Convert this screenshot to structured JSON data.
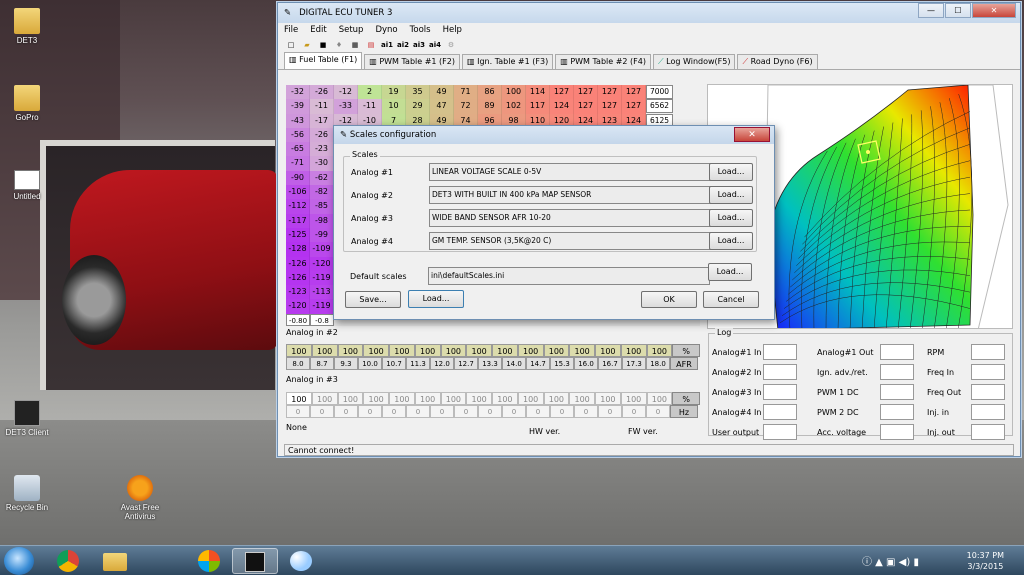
{
  "desktop": {
    "icons": [
      {
        "label": "DET3",
        "icon": "folder-icon"
      },
      {
        "label": "GoPro",
        "icon": "folder-icon"
      },
      {
        "label": "Untitled",
        "icon": "image-file-icon"
      },
      {
        "label": "DET3 Client",
        "icon": "det3-app-icon"
      },
      {
        "label": "Recycle Bin",
        "icon": "recycle-bin-icon"
      },
      {
        "label": "Avast Free Antivirus",
        "icon": "avast-icon"
      }
    ]
  },
  "window": {
    "title": "DIGITAL ECU TUNER 3",
    "controls": {
      "minimize": "—",
      "maximize": "☐",
      "close": "✕"
    },
    "menu": [
      "File",
      "Edit",
      "Setup",
      "Dyno",
      "Tools",
      "Help"
    ],
    "toolbar": [
      "new-icon",
      "open-icon",
      "save-icon",
      "stamp-icon",
      "chip-icon",
      "table-icon",
      "ai1",
      "ai2",
      "ai3",
      "ai4",
      "gear-icon"
    ],
    "tabs": [
      "Fuel Table (F1)",
      "PWM Table #1 (F2)",
      "Ign. Table #1 (F3)",
      "PWM Table #2 (F4)",
      "Log Window(F5)",
      "Road Dyno (F6)"
    ],
    "colors": {
      "accent": "#c7453a",
      "titlebar": "#c6d8ec"
    }
  },
  "fuel_table": {
    "rows": [
      {
        "cells": [
          "-32",
          "-26",
          "-12",
          "2",
          "19",
          "35",
          "49",
          "71",
          "86",
          "100",
          "114",
          "127",
          "127",
          "127",
          "127"
        ],
        "rpm": "7000"
      },
      {
        "cells": [
          "-39",
          "-11",
          "-33",
          "-11",
          "10",
          "29",
          "47",
          "72",
          "89",
          "102",
          "117",
          "124",
          "127",
          "127",
          "127"
        ],
        "rpm": "6562"
      },
      {
        "cells": [
          "-43",
          "-17",
          "-12",
          "-10",
          "7",
          "28",
          "49",
          "74",
          "96",
          "98",
          "110",
          "120",
          "124",
          "123",
          "124"
        ],
        "rpm": "6125"
      },
      {
        "cells": [
          "-56",
          "-26",
          "",
          "",
          "",
          "",
          "",
          "",
          "",
          "",
          "",
          "",
          "",
          "",
          ""
        ],
        "rpm": ""
      },
      {
        "cells": [
          "-65",
          "-23",
          "",
          "",
          "",
          "",
          "",
          "",
          "",
          "",
          "",
          "",
          "",
          "",
          ""
        ],
        "rpm": ""
      },
      {
        "cells": [
          "-71",
          "-30",
          "",
          "",
          "",
          "",
          "",
          "",
          "",
          "",
          "",
          "",
          "",
          "",
          ""
        ],
        "rpm": ""
      },
      {
        "cells": [
          "-90",
          "-62",
          "",
          "",
          "",
          "",
          "",
          "",
          "",
          "",
          "",
          "",
          "",
          "",
          ""
        ],
        "rpm": ""
      },
      {
        "cells": [
          "-106",
          "-82",
          "",
          "",
          "",
          "",
          "",
          "",
          "",
          "",
          "",
          "",
          "",
          "",
          ""
        ],
        "rpm": ""
      },
      {
        "cells": [
          "-112",
          "-85",
          "",
          "",
          "",
          "",
          "",
          "",
          "",
          "",
          "",
          "",
          "",
          "",
          ""
        ],
        "rpm": ""
      },
      {
        "cells": [
          "-117",
          "-98",
          "",
          "",
          "",
          "",
          "",
          "",
          "",
          "",
          "",
          "",
          "",
          "",
          ""
        ],
        "rpm": ""
      },
      {
        "cells": [
          "-125",
          "-99",
          "",
          "",
          "",
          "",
          "",
          "",
          "",
          "",
          "",
          "",
          "",
          "",
          ""
        ],
        "rpm": ""
      },
      {
        "cells": [
          "-128",
          "-109",
          "",
          "",
          "",
          "",
          "",
          "",
          "",
          "",
          "",
          "",
          "",
          "",
          ""
        ],
        "rpm": ""
      },
      {
        "cells": [
          "-126",
          "-120",
          "",
          "",
          "",
          "",
          "",
          "",
          "",
          "",
          "",
          "",
          "",
          "",
          ""
        ],
        "rpm": ""
      },
      {
        "cells": [
          "-126",
          "-119",
          "",
          "",
          "",
          "",
          "",
          "",
          "",
          "",
          "",
          "",
          "",
          "",
          ""
        ],
        "rpm": ""
      },
      {
        "cells": [
          "-123",
          "-113",
          "",
          "",
          "",
          "",
          "",
          "",
          "",
          "",
          "",
          "",
          "",
          "",
          ""
        ],
        "rpm": ""
      },
      {
        "cells": [
          "-120",
          "-119",
          "",
          "",
          "",
          "",
          "",
          "",
          "",
          "",
          "",
          "",
          "",
          "",
          ""
        ],
        "rpm": ""
      }
    ],
    "footer": [
      "-0.80",
      "-0.8"
    ]
  },
  "analog2": {
    "label": "Analog in #2",
    "top": [
      "100",
      "100",
      "100",
      "100",
      "100",
      "100",
      "100",
      "100",
      "100",
      "100",
      "100",
      "100",
      "100",
      "100",
      "100"
    ],
    "top_unit": "%",
    "bottom": [
      "8.0",
      "8.7",
      "9.3",
      "10.0",
      "10.7",
      "11.3",
      "12.0",
      "12.7",
      "13.3",
      "14.0",
      "14.7",
      "15.3",
      "16.0",
      "16.7",
      "17.3",
      "18.0"
    ],
    "bottom_unit": "AFR"
  },
  "analog3": {
    "label": "Analog in #3",
    "top": [
      "100",
      "100",
      "100",
      "100",
      "100",
      "100",
      "100",
      "100",
      "100",
      "100",
      "100",
      "100",
      "100",
      "100",
      "100"
    ],
    "top_unit": "%",
    "bottom": [
      "0",
      "0",
      "0",
      "0",
      "0",
      "0",
      "0",
      "0",
      "0",
      "0",
      "0",
      "0",
      "0",
      "0",
      "0",
      "0"
    ],
    "bottom_unit": "Hz"
  },
  "info": {
    "none": "None",
    "hw": "HW ver.",
    "fw": "FW ver."
  },
  "log": {
    "title": "Log",
    "col1": [
      "Analog#1 In",
      "Analog#2 In",
      "Analog#3 In",
      "Analog#4 In",
      "User output"
    ],
    "col2": [
      "Analog#1 Out",
      "Ign. adv./ret.",
      "PWM 1 DC",
      "PWM 2 DC",
      "Acc. voltage"
    ],
    "col3": [
      "RPM",
      "Freq In",
      "Freq Out",
      "Inj. in",
      "Inj. out"
    ]
  },
  "status": "Cannot connect!",
  "dialog": {
    "title": "Scales configuration",
    "close": "✕",
    "group_label": "Scales",
    "rows": [
      {
        "label": "Analog #1",
        "value": "LINEAR VOLTAGE SCALE 0-5V",
        "button": "Load..."
      },
      {
        "label": "Analog #2",
        "value": "DET3 WITH BUILT IN 400 kPa MAP SENSOR",
        "button": "Load..."
      },
      {
        "label": "Analog #3",
        "value": "WIDE BAND SENSOR AFR 10-20",
        "button": "Load..."
      },
      {
        "label": "Analog #4",
        "value": "GM TEMP. SENSOR (3,5K@20 C)",
        "button": "Load..."
      }
    ],
    "default_label": "Default scales",
    "default_value": "ini\\defaultScales.ini",
    "default_button": "Load...",
    "save": "Save...",
    "load": "Load...",
    "ok": "OK",
    "cancel": "Cancel"
  },
  "taskbar": {
    "items": [
      "windows-start-icon",
      "chrome-icon",
      "explorer-icon",
      "windows-media-icon",
      "det3-app-icon",
      "paint-icon"
    ],
    "time": "10:37 PM",
    "date": "3/3/2015"
  }
}
